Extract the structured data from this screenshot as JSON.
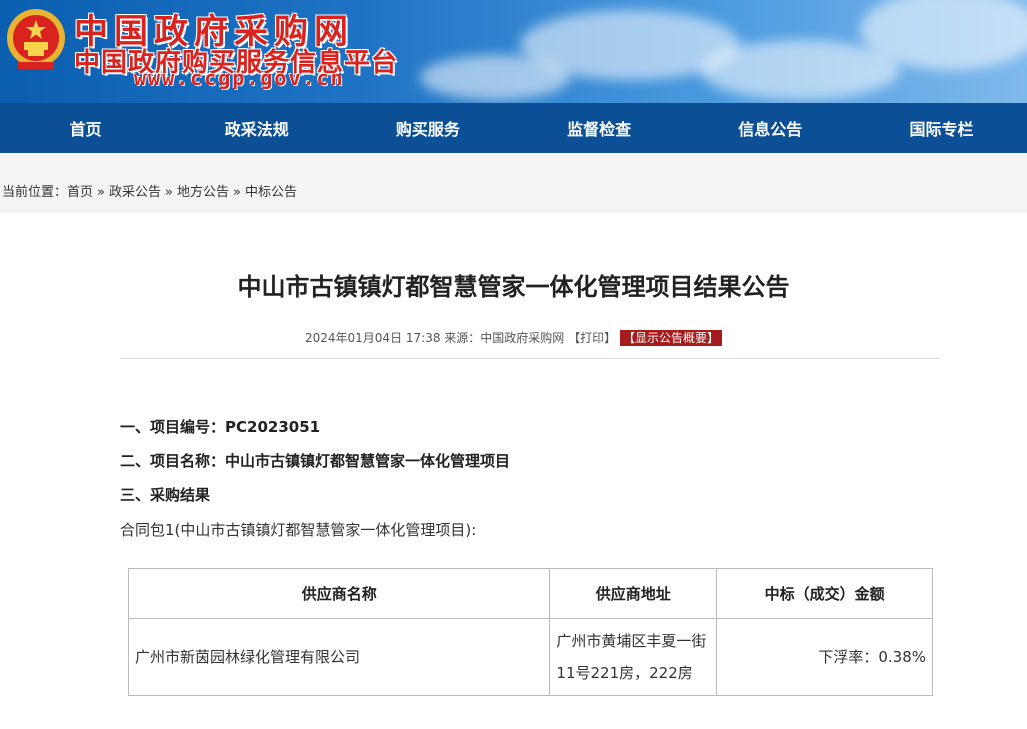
{
  "header": {
    "site_title": "中国政府采购网",
    "site_subtitle": "中国政府购买服务信息平台",
    "site_url": "www.ccgp.gov.cn"
  },
  "nav": {
    "items": [
      "首页",
      "政采法规",
      "购买服务",
      "监督检查",
      "信息公告",
      "国际专栏"
    ]
  },
  "breadcrumb": {
    "prefix": "当前位置：",
    "items": [
      "首页",
      "政采公告",
      "地方公告",
      "中标公告"
    ],
    "separator": "»"
  },
  "article": {
    "title": "中山市古镇镇灯都智慧管家一体化管理项目结果公告",
    "date": "2024年01月04日 17:38",
    "source": "来源：中国政府采购网",
    "print": "【打印】",
    "summary": "【显示公告概要】",
    "sec1": "一、项目编号：PC2023051",
    "sec2": "二、项目名称：中山市古镇镇灯都智慧管家一体化管理项目",
    "sec3": "三、采购结果",
    "package": "合同包1(中山市古镇镇灯都智慧管家一体化管理项目):"
  },
  "table": {
    "headers": [
      "供应商名称",
      "供应商地址",
      "中标（成交）金额"
    ],
    "rows": [
      [
        "广州市新茵园林绿化管理有限公司",
        "广州市黄埔区丰夏一街11号221房，222房",
        "下浮率：0.38%"
      ]
    ]
  },
  "colors": {
    "nav_bg": "#0b4f96",
    "title_red": "#d8231e",
    "summary_bg": "#a61b1b"
  }
}
